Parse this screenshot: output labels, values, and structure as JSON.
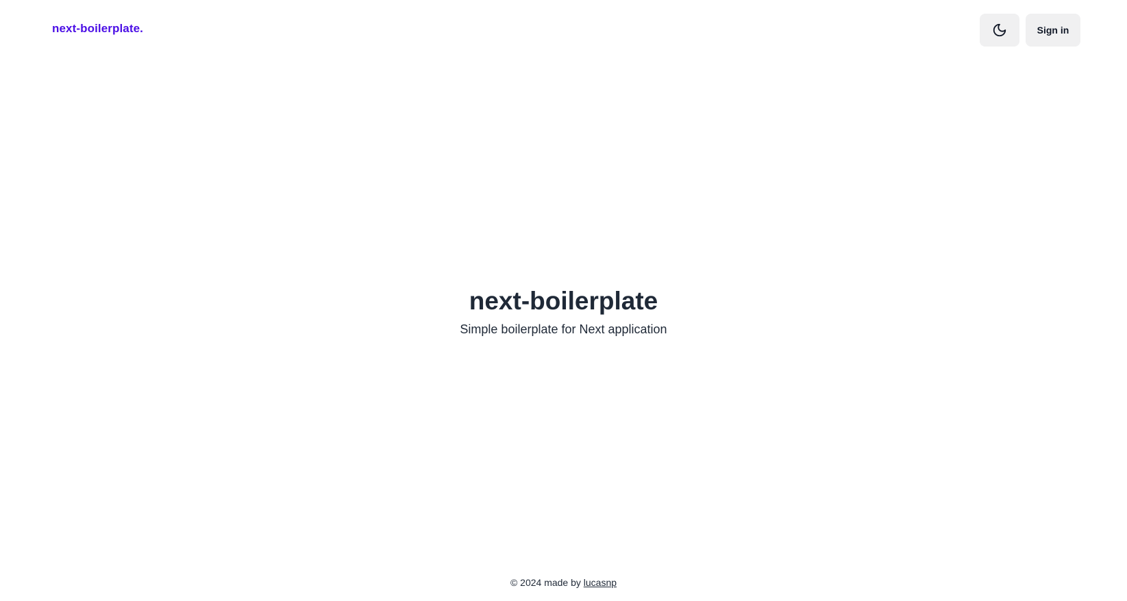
{
  "header": {
    "logo_text": "next-boilerplate.",
    "theme_toggle_icon": "moon-icon",
    "signin_label": "Sign in"
  },
  "hero": {
    "title": "next-boilerplate",
    "subtitle": "Simple boilerplate for Next application"
  },
  "footer": {
    "prefix": "© 2024 made by ",
    "author_link": "lucasnp"
  },
  "colors": {
    "brand": "#4c10e6",
    "text": "#1f2937",
    "button_bg": "#f0f0f1"
  }
}
